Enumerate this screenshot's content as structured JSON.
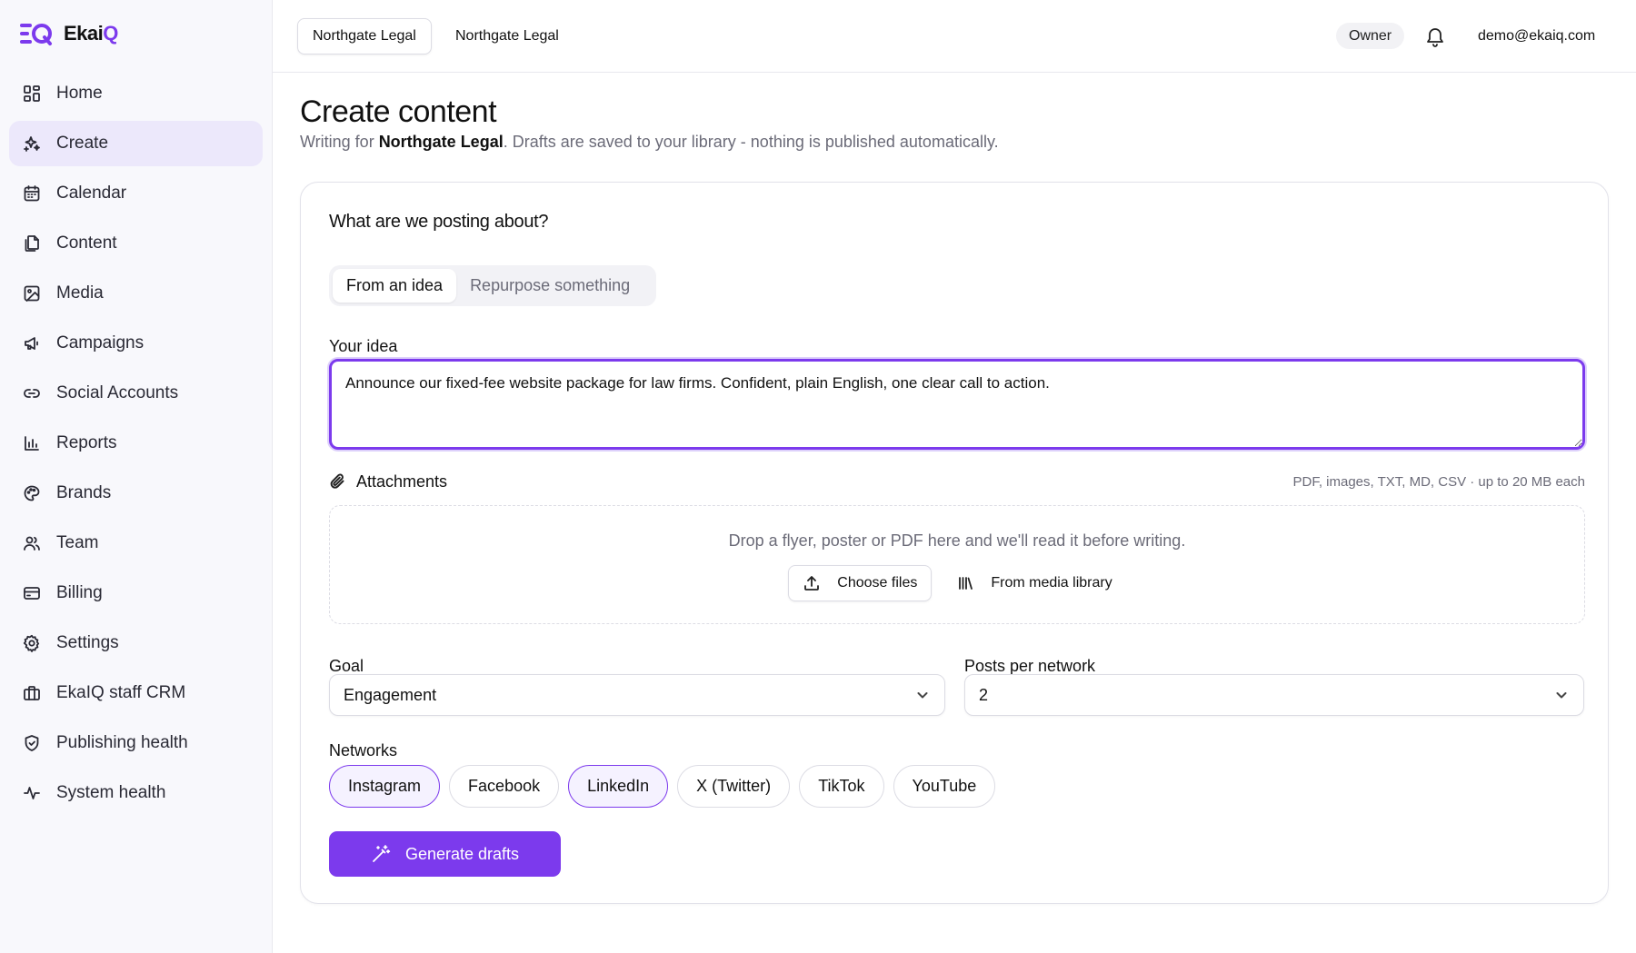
{
  "brand": {
    "name_prefix": "Ekai",
    "name_suffix": "Q",
    "accent_color": "#7c3aed"
  },
  "sidebar": {
    "items": [
      {
        "label": "Home",
        "icon": "dashboard-icon"
      },
      {
        "label": "Create",
        "icon": "sparkles-icon",
        "active": true
      },
      {
        "label": "Calendar",
        "icon": "calendar-icon"
      },
      {
        "label": "Content",
        "icon": "documents-icon"
      },
      {
        "label": "Media",
        "icon": "image-icon"
      },
      {
        "label": "Campaigns",
        "icon": "megaphone-icon"
      },
      {
        "label": "Social Accounts",
        "icon": "link-icon"
      },
      {
        "label": "Reports",
        "icon": "bar-chart-icon"
      },
      {
        "label": "Brands",
        "icon": "palette-icon"
      },
      {
        "label": "Team",
        "icon": "users-icon"
      },
      {
        "label": "Billing",
        "icon": "credit-card-icon"
      },
      {
        "label": "Settings",
        "icon": "gear-icon"
      },
      {
        "label": "EkaIQ staff CRM",
        "icon": "briefcase-icon"
      },
      {
        "label": "Publishing health",
        "icon": "shield-icon"
      },
      {
        "label": "System health",
        "icon": "activity-icon"
      }
    ]
  },
  "topbar": {
    "workspace_selected": "Northgate Legal",
    "workspace_name": "Northgate Legal",
    "role": "Owner",
    "email": "demo@ekaiq.com"
  },
  "page": {
    "title": "Create content",
    "subtitle_prefix": "Writing for ",
    "subtitle_brand": "Northgate Legal",
    "subtitle_suffix": ". Drafts are saved to your library - nothing is published automatically."
  },
  "form": {
    "heading": "What are we posting about?",
    "modes": [
      {
        "label": "From an idea",
        "active": true
      },
      {
        "label": "Repurpose something",
        "active": false
      }
    ],
    "idea_label": "Your idea",
    "idea_value": "Announce our fixed-fee website package for law firms. Confident, plain English, one clear call to action.",
    "attachments_label": "Attachments",
    "attachments_hint": "PDF, images, TXT, MD, CSV · up to 20 MB each",
    "drop_text": "Drop a flyer, poster or PDF here and we'll read it before writing.",
    "choose_files": "Choose files",
    "media_library": "From media library",
    "goal_label": "Goal",
    "goal_value": "Engagement",
    "posts_label": "Posts per network",
    "posts_value": "2",
    "networks_label": "Networks",
    "networks": [
      {
        "label": "Instagram",
        "selected": true
      },
      {
        "label": "Facebook",
        "selected": false
      },
      {
        "label": "LinkedIn",
        "selected": true
      },
      {
        "label": "X (Twitter)",
        "selected": false
      },
      {
        "label": "TikTok",
        "selected": false
      },
      {
        "label": "YouTube",
        "selected": false
      }
    ],
    "generate_label": "Generate drafts"
  }
}
